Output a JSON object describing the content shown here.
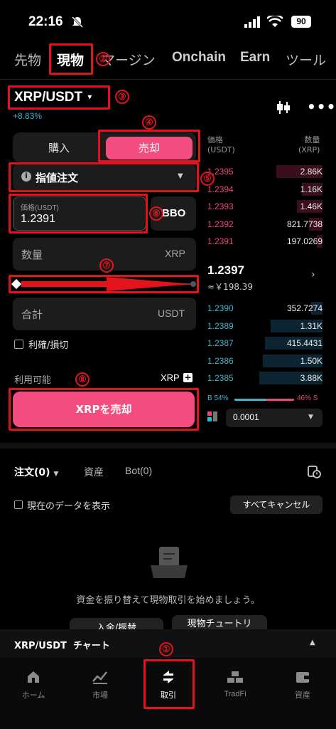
{
  "status_bar": {
    "time": "22:16",
    "battery": "90"
  },
  "top_tabs": [
    "先物",
    "現物",
    "マージン",
    "Onchain",
    "Earn",
    "ツール"
  ],
  "pair": {
    "name": "XRP/USDT",
    "change": "+8.83%"
  },
  "side_toggle": {
    "buy": "購入",
    "sell": "売却"
  },
  "order_type": "指値注文",
  "price_field": {
    "label": "価格(USDT)",
    "value": "1.2391",
    "bbo": "BBO"
  },
  "qty_field": {
    "placeholder": "数量",
    "unit": "XRP"
  },
  "slider": {
    "value_percent": 0
  },
  "total_field": {
    "placeholder": "合計",
    "unit": "USDT"
  },
  "tpsl_label": "利確/損切",
  "available": {
    "label": "利用可能",
    "unit": "XRP"
  },
  "sell_button": "XRPを売却",
  "orderbook": {
    "price_header": "価格\n(USDT)",
    "qty_header": "数量\n(XRP)",
    "asks": [
      {
        "price": "1.2395",
        "qty": "2.86K",
        "depth": 0.4
      },
      {
        "price": "1.2394",
        "qty": "1.16K",
        "depth": 0.18
      },
      {
        "price": "1.2393",
        "qty": "1.46K",
        "depth": 0.22
      },
      {
        "price": "1.2392",
        "qty": "821.7738",
        "depth": 0.12
      },
      {
        "price": "1.2391",
        "qty": "197.0269",
        "depth": 0.05
      }
    ],
    "mid_price": "1.2397",
    "mid_fiat": "≈￥198.39",
    "bids": [
      {
        "price": "1.2390",
        "qty": "352.7274",
        "depth": 0.1
      },
      {
        "price": "1.2389",
        "qty": "1.31K",
        "depth": 0.45
      },
      {
        "price": "1.2387",
        "qty": "415.4431",
        "depth": 0.5
      },
      {
        "price": "1.2386",
        "qty": "1.50K",
        "depth": 0.52
      },
      {
        "price": "1.2385",
        "qty": "3.88K",
        "depth": 0.55
      }
    ],
    "ratio": {
      "buy": "B 54%",
      "sell": "46% S",
      "buy_fraction": 0.54
    },
    "precision": "0.0001"
  },
  "orders_tabs": {
    "orders": "注文(0)",
    "assets": "資産",
    "bot": "Bot(0)"
  },
  "show_current_data": "現在のデータを表示",
  "cancel_all": "すべてキャンセル",
  "empty_message": "資金を振り替えて現物取引を始めましょう。",
  "empty_buttons": {
    "deposit": "入金/振替",
    "tutorial": "現物チュートリ"
  },
  "chart_bar": "XRP/USDT  チャート",
  "bottom_nav": [
    "ホーム",
    "市場",
    "取引",
    "TradFi",
    "資産"
  ],
  "annotations": [
    "①",
    "②",
    "③",
    "④",
    "⑤",
    "⑥",
    "⑦",
    "⑧"
  ],
  "colors": {
    "accent_pink": "#f24c81",
    "ask_red": "#f0467a",
    "bid_teal": "#3bb7cf",
    "annotation_red": "#e2131d"
  }
}
